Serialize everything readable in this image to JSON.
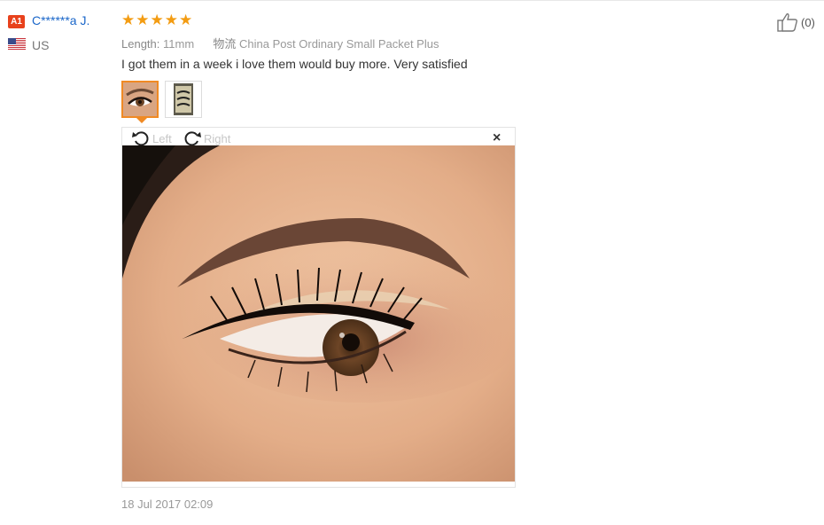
{
  "user": {
    "badge": "A1",
    "name": "C******a J.",
    "country": "US"
  },
  "review": {
    "rating": 5,
    "length_label": "Length:",
    "length_value": "11mm",
    "shipping_label": "物流",
    "shipping_value": "China Post Ordinary Small Packet Plus",
    "text": "I got them in a week i love them would buy more. Very satisfied",
    "date": "18 Jul 2017 02:09"
  },
  "viewer": {
    "rotate_left_label": "Left",
    "rotate_right_label": "Right",
    "close_label": "×"
  },
  "helpful": {
    "count": "(0)"
  },
  "icons": [
    "flag-us-icon",
    "star-icon",
    "rotate-left-icon",
    "rotate-right-icon",
    "close-icon",
    "thumbs-up-icon"
  ],
  "colors": {
    "accent_orange": "#f08a24",
    "star": "#f39c12",
    "link_blue": "#1a66c9",
    "badge_red": "#e8411c"
  }
}
